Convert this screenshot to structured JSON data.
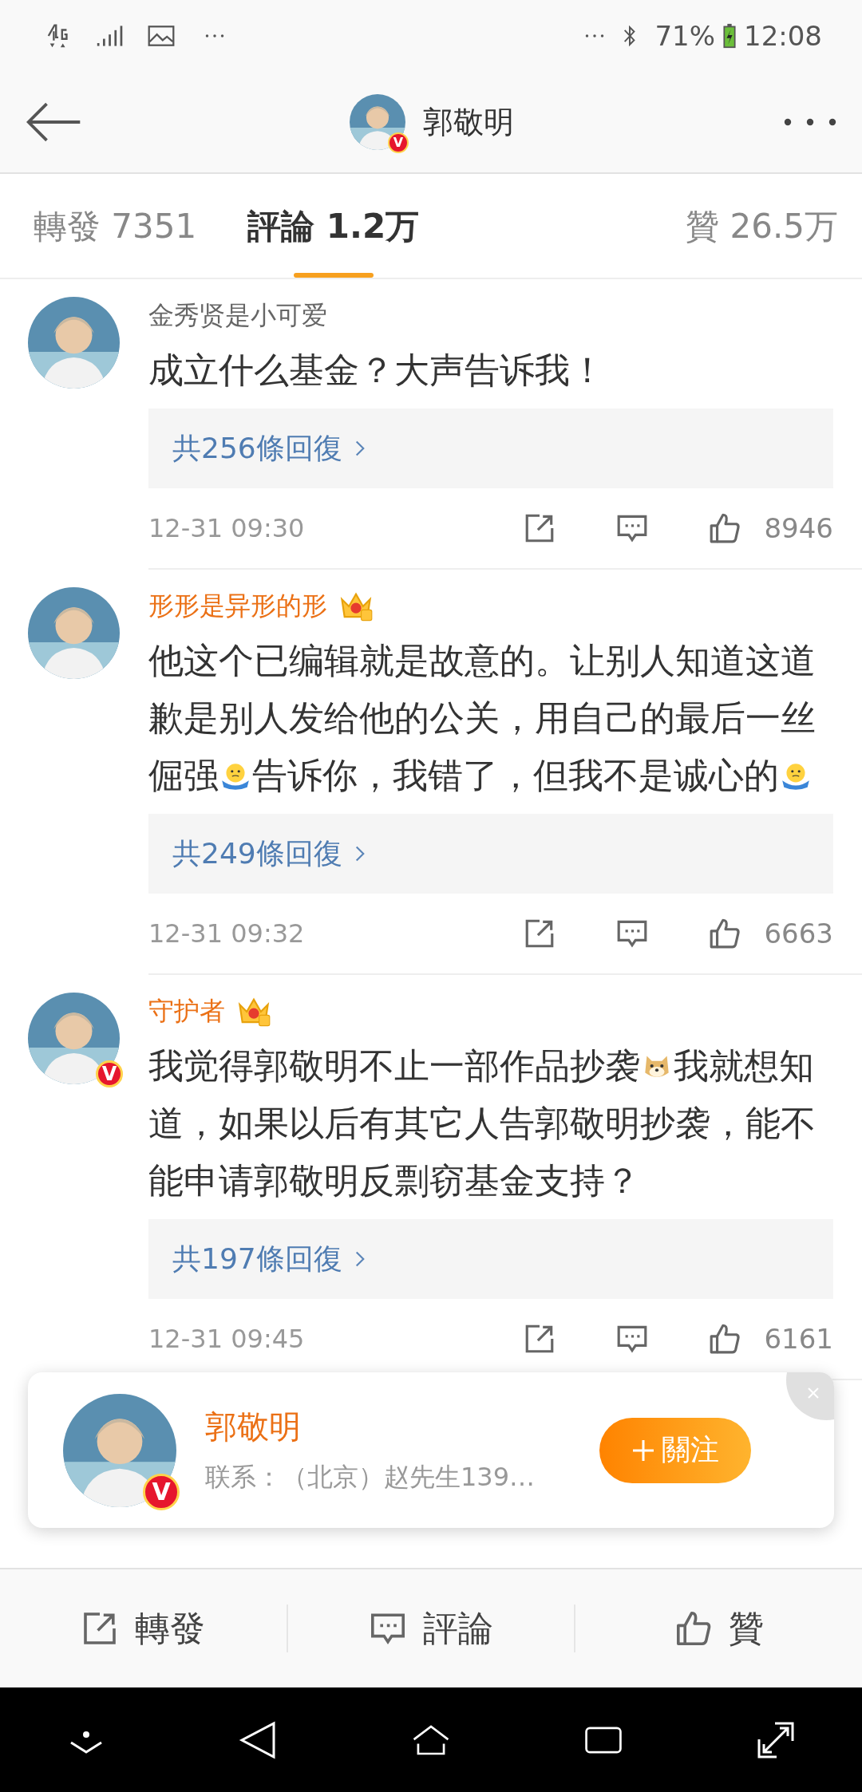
{
  "status_bar": {
    "battery": "71%",
    "time": "12:08"
  },
  "header": {
    "title": "郭敬明",
    "verified_badge": "V"
  },
  "tabs": [
    {
      "label": "轉發 7351",
      "selected": false
    },
    {
      "label": "評論 1.2万",
      "selected": true
    },
    {
      "label": "贊 26.5万",
      "selected": false
    }
  ],
  "comments": [
    {
      "user": "金秀贤是小可爱",
      "vip": false,
      "content": [
        {
          "kind": "text",
          "text": "成立什么基金？大声告诉我！"
        }
      ],
      "replies": "共256條回復",
      "time": "12-31 09:30",
      "likes": "8946"
    },
    {
      "user": "形形是异形的形",
      "vip": true,
      "content": [
        {
          "kind": "text",
          "text": "他这个已编辑就是故意的。让别人知道这道歉是别人发给他的公关，用自己的最后一丝倔强"
        },
        {
          "kind": "shrug"
        },
        {
          "kind": "text",
          "text": "告诉你，我错了，但我不是诚心的"
        },
        {
          "kind": "shrug"
        }
      ],
      "replies": "共249條回復",
      "time": "12-31 09:32",
      "likes": "6663"
    },
    {
      "user": "守护者",
      "vip": true,
      "verified_badge": "V",
      "content": [
        {
          "kind": "text",
          "text": "我觉得郭敬明不止一部作品抄袭"
        },
        {
          "kind": "dog"
        },
        {
          "kind": "text",
          "text": "我就想知道，如果以后有其它人告郭敬明抄袭，能不能申请郭敬明反剽窃基金支持？"
        }
      ],
      "replies": "共197條回復",
      "time": "12-31 09:45",
      "likes": "6161"
    }
  ],
  "follow_card": {
    "name": "郭敬明",
    "verified_badge": "V",
    "subtitle": "联系：（北京）赵先生139…",
    "button": "關注"
  },
  "action_bar": [
    {
      "kind": "share",
      "label": "轉發"
    },
    {
      "kind": "comment",
      "label": "評論"
    },
    {
      "kind": "like",
      "label": "贊"
    }
  ]
}
